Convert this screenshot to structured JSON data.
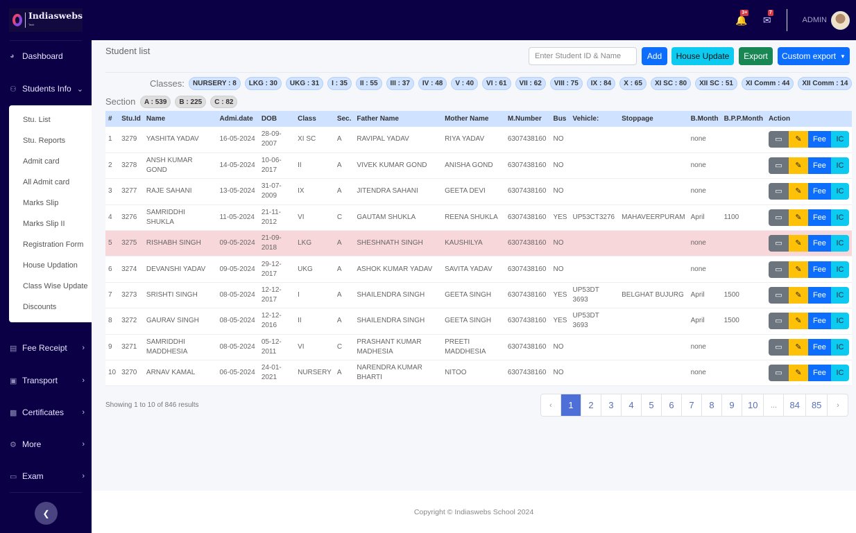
{
  "brand": {
    "name": "Indiaswebs",
    "sub": "Tech"
  },
  "header": {
    "notifications_badge": "3+",
    "messages_badge": "7",
    "user_label": "ADMIN"
  },
  "sidebar": {
    "items": [
      {
        "label": "Dashboard",
        "icon": "dashboard-icon"
      },
      {
        "label": "Students Info",
        "icon": "users-icon"
      },
      {
        "label": "Fee Receipt",
        "icon": "receipt-icon"
      },
      {
        "label": "Transport",
        "icon": "bus-icon"
      },
      {
        "label": "Certificates",
        "icon": "certificate-icon"
      },
      {
        "label": "More",
        "icon": "gear-icon"
      },
      {
        "label": "Exam",
        "icon": "exam-icon"
      }
    ],
    "submenu": [
      "Stu. List",
      "Stu. Reports",
      "Admit card",
      "All Admit card",
      "Marks Slip",
      "Marks Slip II",
      "Registration Form",
      "House Updation",
      "Class Wise Update",
      "Discounts"
    ]
  },
  "page": {
    "title": "Student list",
    "search_placeholder": "Enter Student ID & Name",
    "buttons": {
      "add": "Add",
      "house_update": "House Update",
      "export": "Export",
      "custom_export": "Custom export"
    },
    "classes_label": "Classes:",
    "classes": [
      "NURSERY : 8",
      "LKG : 30",
      "UKG : 31",
      "I : 35",
      "II : 55",
      "III : 37",
      "IV : 48",
      "V : 40",
      "VI : 61",
      "VII : 62",
      "VIII : 75",
      "IX : 84",
      "X : 65",
      "XI SC : 80",
      "XII SC : 51",
      "XI Comm : 44",
      "XII Comm : 14"
    ],
    "section_label": "Section",
    "sections": [
      "A : 539",
      "B : 225",
      "C : 82"
    ]
  },
  "table": {
    "columns": [
      "#",
      "Stu.Id",
      "Name",
      "Admi.date",
      "DOB",
      "Class",
      "Sec.",
      "Father Name",
      "Mother Name",
      "M.Number",
      "Bus",
      "Vehicle:",
      "Stoppage",
      "B.Month",
      "B.P.P.Month",
      "Action"
    ],
    "action_labels": {
      "fee": "Fee",
      "ic": "IC"
    },
    "rows": [
      [
        "1",
        "3279",
        "YASHITA YADAV",
        "16-05-2024",
        "28-09-2007",
        "XI SC",
        "A",
        "RAVIPAL YADAV",
        "RIYA YADAV",
        "6307438160",
        "NO",
        "",
        "",
        "none",
        ""
      ],
      [
        "2",
        "3278",
        "ANSH KUMAR GOND",
        "14-05-2024",
        "10-06-2017",
        "II",
        "A",
        "VIVEK KUMAR GOND",
        "ANISHA GOND",
        "6307438160",
        "NO",
        "",
        "",
        "none",
        ""
      ],
      [
        "3",
        "3277",
        "RAJE SAHANI",
        "13-05-2024",
        "31-07-2009",
        "IX",
        "A",
        "JITENDRA SAHANI",
        "GEETA DEVI",
        "6307438160",
        "NO",
        "",
        "",
        "none",
        ""
      ],
      [
        "4",
        "3276",
        "SAMRIDDHI SHUKLA",
        "11-05-2024",
        "21-11-2012",
        "VI",
        "C",
        "GAUTAM SHUKLA",
        "REENA SHUKLA",
        "6307438160",
        "YES",
        "UP53CT3276",
        "MAHAVEERPURAM",
        "April",
        "1100"
      ],
      [
        "5",
        "3275",
        "RISHABH SINGH",
        "09-05-2024",
        "21-09-2018",
        "LKG",
        "A",
        "SHESHNATH SINGH",
        "KAUSHILYA",
        "6307438160",
        "NO",
        "",
        "",
        "none",
        ""
      ],
      [
        "6",
        "3274",
        "DEVANSHI YADAV",
        "09-05-2024",
        "29-12-2017",
        "UKG",
        "A",
        "ASHOK KUMAR YADAV",
        "SAVITA YADAV",
        "6307438160",
        "NO",
        "",
        "",
        "none",
        ""
      ],
      [
        "7",
        "3273",
        "SRISHTI SINGH",
        "08-05-2024",
        "12-12-2017",
        "I",
        "A",
        "SHAILENDRA SINGH",
        "GEETA SINGH",
        "6307438160",
        "YES",
        "UP53DT 3693",
        "BELGHAT BUJURG",
        "April",
        "1500"
      ],
      [
        "8",
        "3272",
        "GAURAV SINGH",
        "08-05-2024",
        "12-12-2016",
        "II",
        "A",
        "SHAILENDRA SINGH",
        "GEETA SINGH",
        "6307438160",
        "YES",
        "UP53DT 3693",
        "",
        "April",
        "1500"
      ],
      [
        "9",
        "3271",
        "SAMRIDDHI MADDHESIA",
        "08-05-2024",
        "05-12-2011",
        "VI",
        "C",
        "PRASHANT KUMAR MADHESIA",
        "PREETI MADDHESIA",
        "6307438160",
        "NO",
        "",
        "",
        "none",
        ""
      ],
      [
        "10",
        "3270",
        "ARNAV KAMAL",
        "06-05-2024",
        "24-01-2021",
        "NURSERY",
        "A",
        "NARENDRA KUMAR BHARTI",
        "NITOO",
        "6307438160",
        "NO",
        "",
        "",
        "none",
        ""
      ]
    ],
    "highlighted_row": 4
  },
  "pagination": {
    "summary": "Showing 1 to 10 of 846 results",
    "pages": [
      "‹",
      "1",
      "2",
      "3",
      "4",
      "5",
      "6",
      "7",
      "8",
      "9",
      "10",
      "...",
      "84",
      "85",
      "›"
    ],
    "active": "1"
  },
  "footer": {
    "text": "Copyright © Indiaswebs School 2024"
  },
  "colors": {
    "navbar": "#0b0046",
    "primary": "#0d6efd",
    "info": "#0dcaf0",
    "success": "#198754",
    "warning": "#ffc107",
    "danger_row": "#f8d7da"
  }
}
